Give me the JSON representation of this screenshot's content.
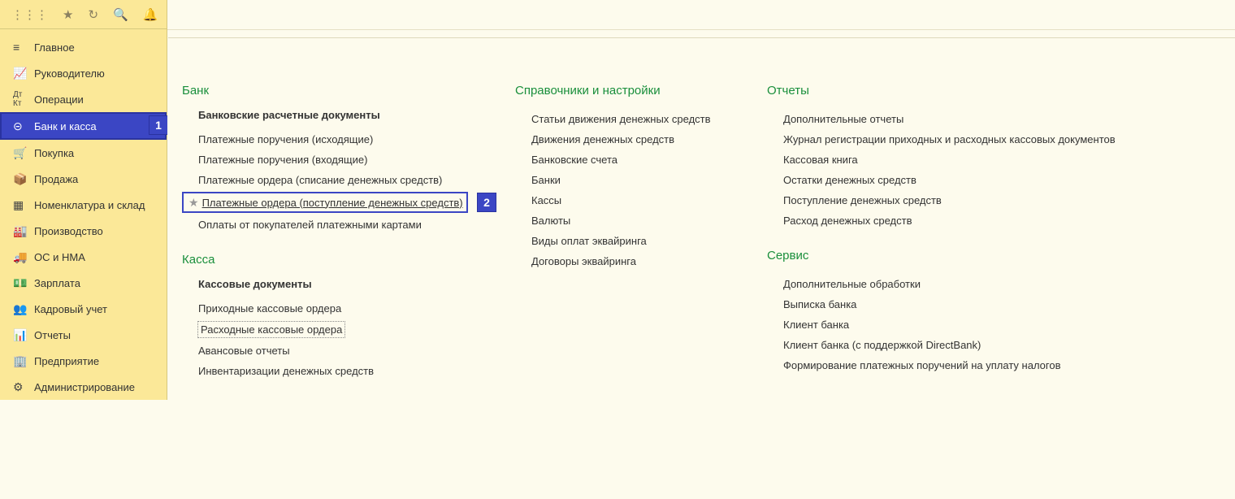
{
  "sidebar": {
    "items": [
      {
        "label": "Главное"
      },
      {
        "label": "Руководителю"
      },
      {
        "label": "Операции"
      },
      {
        "label": "Банк и касса"
      },
      {
        "label": "Покупка"
      },
      {
        "label": "Продажа"
      },
      {
        "label": "Номенклатура и склад"
      },
      {
        "label": "Производство"
      },
      {
        "label": "ОС и НМА"
      },
      {
        "label": "Зарплата"
      },
      {
        "label": "Кадровый учет"
      },
      {
        "label": "Отчеты"
      },
      {
        "label": "Предприятие"
      },
      {
        "label": "Администрирование"
      }
    ]
  },
  "badges": {
    "one": "1",
    "two": "2"
  },
  "sections": {
    "bank": {
      "title": "Банк",
      "group": "Банковские расчетные документы",
      "links": [
        "Платежные поручения (исходящие)",
        "Платежные поручения (входящие)",
        "Платежные ордера (списание денежных средств)",
        "Платежные ордера (поступление денежных средств)",
        "Оплаты от покупателей платежными картами"
      ]
    },
    "kassa": {
      "title": "Касса",
      "group": "Кассовые документы",
      "links": [
        "Приходные кассовые ордера",
        "Расходные кассовые ордера",
        "Авансовые отчеты",
        "Инвентаризации денежных средств"
      ]
    },
    "reference": {
      "title": "Справочники и настройки",
      "links": [
        "Статьи движения денежных средств",
        "Движения денежных средств",
        "Банковские счета",
        "Банки",
        "Кассы",
        "Валюты",
        "Виды оплат эквайринга",
        "Договоры эквайринга"
      ]
    },
    "reports": {
      "title": "Отчеты",
      "links": [
        "Дополнительные отчеты",
        "Журнал регистрации приходных и расходных кассовых документов",
        "Кассовая книга",
        "Остатки денежных средств",
        "Поступление денежных средств",
        "Расход денежных средств"
      ]
    },
    "service": {
      "title": "Сервис",
      "links": [
        "Дополнительные обработки",
        "Выписка банка",
        "Клиент банка",
        "Клиент банка (с поддержкой DirectBank)",
        "Формирование платежных поручений на уплату налогов"
      ]
    }
  }
}
